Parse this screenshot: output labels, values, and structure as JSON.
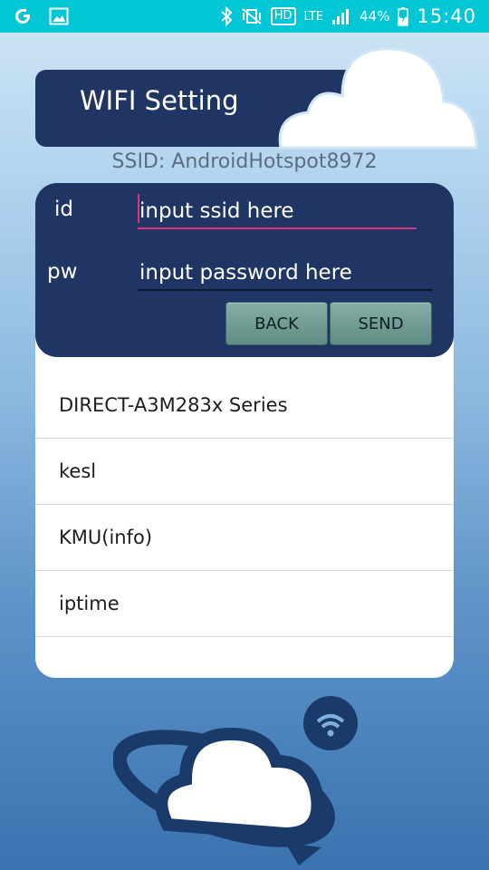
{
  "status_bar": {
    "battery": "44%",
    "network": "LTE",
    "hd": "HD",
    "time": "15:40"
  },
  "header": {
    "title": "WIFI Setting"
  },
  "ssid_label": "SSID: AndroidHotspot8972",
  "form": {
    "id_label": "id",
    "id_placeholder": "input ssid here",
    "pw_label": "pw",
    "pw_placeholder": "input password here",
    "back_label": "BACK",
    "send_label": "SEND"
  },
  "networks": [
    "DIRECT-A3M283x Series",
    "kesl",
    "KMU(info)",
    "iptime"
  ],
  "colors": {
    "status_bar": "#00c6d6",
    "card": "#1f3563",
    "focus_underline": "#e0317a",
    "button": "#6f9a92"
  }
}
